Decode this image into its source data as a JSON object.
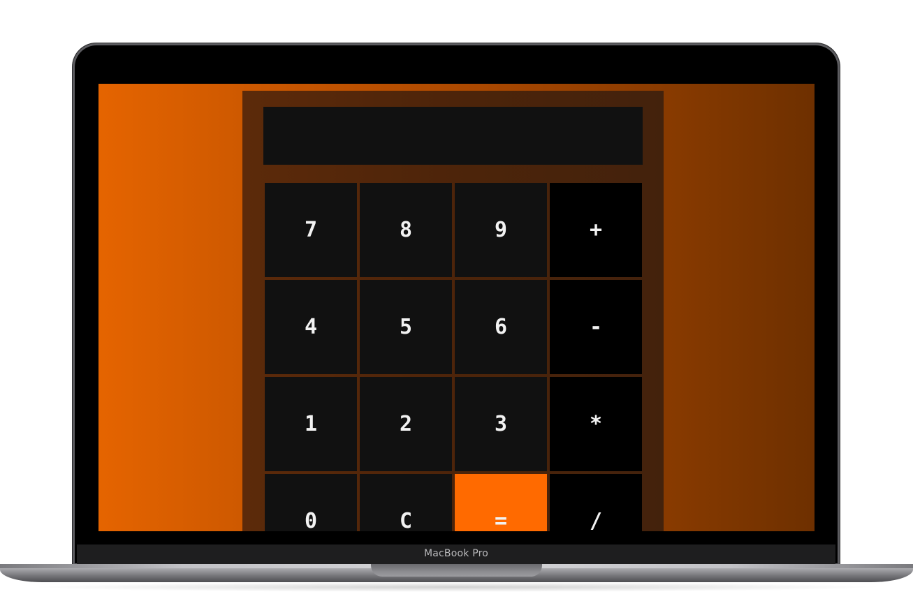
{
  "device": {
    "label": "MacBook Pro"
  },
  "calculator": {
    "display_value": "",
    "keys": [
      {
        "label": "7",
        "kind": "digit"
      },
      {
        "label": "8",
        "kind": "digit"
      },
      {
        "label": "9",
        "kind": "digit"
      },
      {
        "label": "+",
        "kind": "operator"
      },
      {
        "label": "4",
        "kind": "digit"
      },
      {
        "label": "5",
        "kind": "digit"
      },
      {
        "label": "6",
        "kind": "digit"
      },
      {
        "label": "-",
        "kind": "operator"
      },
      {
        "label": "1",
        "kind": "digit"
      },
      {
        "label": "2",
        "kind": "digit"
      },
      {
        "label": "3",
        "kind": "digit"
      },
      {
        "label": "*",
        "kind": "operator"
      },
      {
        "label": "0",
        "kind": "digit"
      },
      {
        "label": "C",
        "kind": "clear"
      },
      {
        "label": "=",
        "kind": "equals"
      },
      {
        "label": "/",
        "kind": "operator"
      }
    ]
  },
  "colors": {
    "accent": "#ff6a00",
    "key_background": "#111111",
    "operator_background": "#000000",
    "calculator_frame": "#4d240a",
    "background_left": "#e56400",
    "background_right": "#6e3000"
  }
}
